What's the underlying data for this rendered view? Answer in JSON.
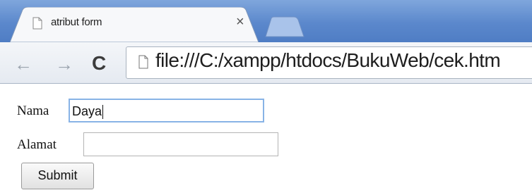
{
  "browser": {
    "tab_title": "atribut form",
    "tab_close_label": "×",
    "url": "file:///C:/xampp/htdocs/BukuWeb/cek.htm",
    "back_label": "←",
    "forward_label": "→",
    "reload_label": "C"
  },
  "form": {
    "nama_label": "Nama",
    "nama_value": "Daya",
    "alamat_label": "Alamat",
    "alamat_value": "",
    "submit_label": "Submit"
  },
  "colors": {
    "titlebar": "#5b88cc",
    "focus_border": "#88b3e6"
  }
}
